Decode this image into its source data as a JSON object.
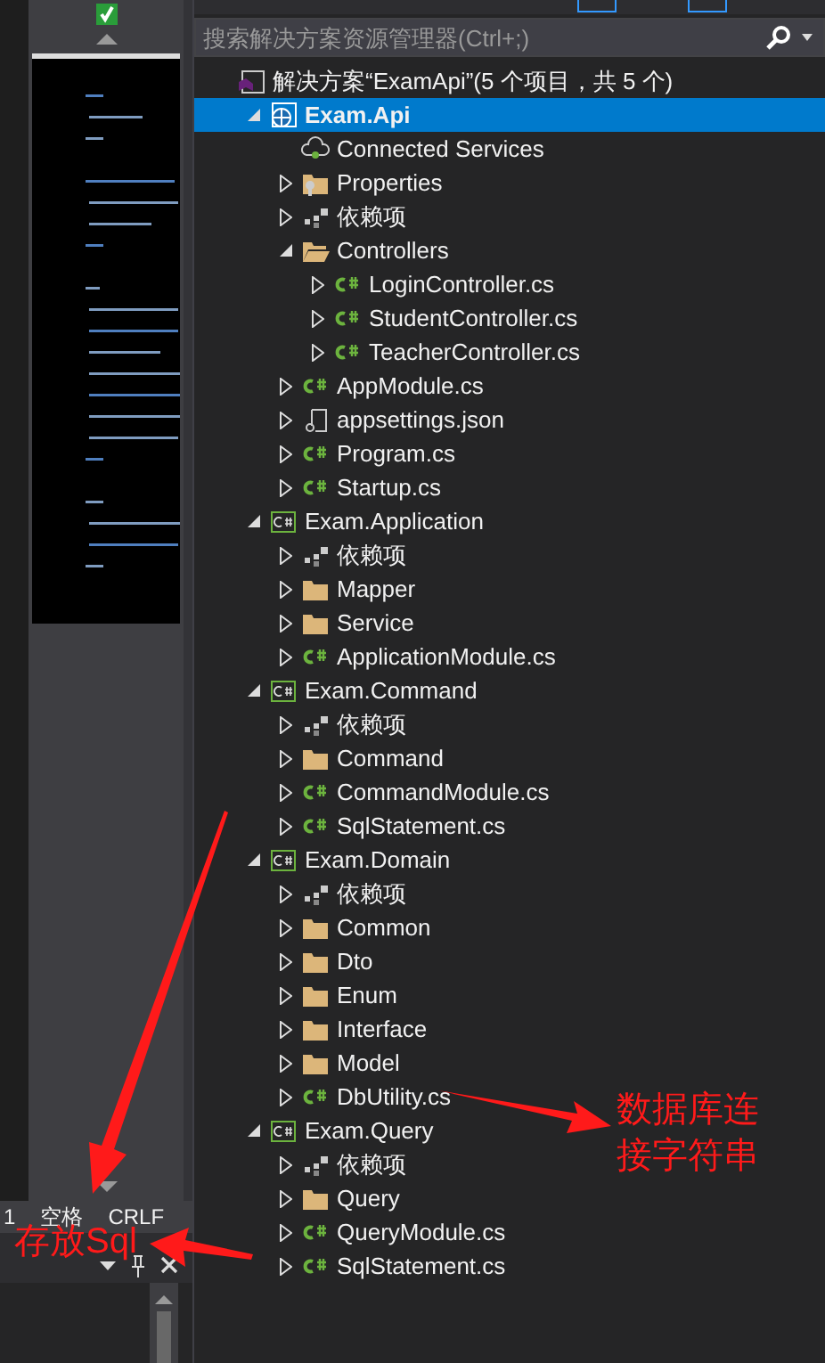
{
  "search": {
    "placeholder": "搜索解决方案资源管理器(Ctrl+;)"
  },
  "status_bar": {
    "column": "1",
    "indent": "空格",
    "line_ending": "CRLF"
  },
  "solution_tree": {
    "label": "解决方案“ExamApi”(5 个项目，共 5 个)",
    "kind": "solution",
    "selected": false,
    "children": [
      {
        "label": "Exam.Api",
        "kind": "web-project",
        "expanded": true,
        "selected": true,
        "children": [
          {
            "label": "Connected Services",
            "kind": "cloud",
            "selected": false
          },
          {
            "label": "Properties",
            "kind": "properties",
            "expanded": false,
            "selected": false
          },
          {
            "label": "依赖项",
            "kind": "dependencies",
            "expanded": false,
            "selected": false
          },
          {
            "label": "Controllers",
            "kind": "folder-open",
            "expanded": true,
            "selected": false,
            "children": [
              {
                "label": "LoginController.cs",
                "kind": "cs-file",
                "expanded": false,
                "selected": false
              },
              {
                "label": "StudentController.cs",
                "kind": "cs-file",
                "expanded": false,
                "selected": false
              },
              {
                "label": "TeacherController.cs",
                "kind": "cs-file",
                "expanded": false,
                "selected": false
              }
            ]
          },
          {
            "label": "AppModule.cs",
            "kind": "cs-file",
            "expanded": false,
            "selected": false
          },
          {
            "label": "appsettings.json",
            "kind": "json-file",
            "expanded": false,
            "selected": false
          },
          {
            "label": "Program.cs",
            "kind": "cs-file",
            "expanded": false,
            "selected": false
          },
          {
            "label": "Startup.cs",
            "kind": "cs-file",
            "expanded": false,
            "selected": false
          }
        ]
      },
      {
        "label": "Exam.Application",
        "kind": "csharp-project",
        "expanded": true,
        "selected": false,
        "children": [
          {
            "label": "依赖项",
            "kind": "dependencies",
            "expanded": false,
            "selected": false
          },
          {
            "label": "Mapper",
            "kind": "folder",
            "expanded": false,
            "selected": false
          },
          {
            "label": "Service",
            "kind": "folder",
            "expanded": false,
            "selected": false
          },
          {
            "label": "ApplicationModule.cs",
            "kind": "cs-file",
            "expanded": false,
            "selected": false
          }
        ]
      },
      {
        "label": "Exam.Command",
        "kind": "csharp-project",
        "expanded": true,
        "selected": false,
        "children": [
          {
            "label": "依赖项",
            "kind": "dependencies",
            "expanded": false,
            "selected": false
          },
          {
            "label": "Command",
            "kind": "folder",
            "expanded": false,
            "selected": false
          },
          {
            "label": "CommandModule.cs",
            "kind": "cs-file",
            "expanded": false,
            "selected": false
          },
          {
            "label": "SqlStatement.cs",
            "kind": "cs-file",
            "expanded": false,
            "selected": false
          }
        ]
      },
      {
        "label": "Exam.Domain",
        "kind": "csharp-project",
        "expanded": true,
        "selected": false,
        "children": [
          {
            "label": "依赖项",
            "kind": "dependencies",
            "expanded": false,
            "selected": false
          },
          {
            "label": "Common",
            "kind": "folder",
            "expanded": false,
            "selected": false
          },
          {
            "label": "Dto",
            "kind": "folder",
            "expanded": false,
            "selected": false
          },
          {
            "label": "Enum",
            "kind": "folder",
            "expanded": false,
            "selected": false
          },
          {
            "label": "Interface",
            "kind": "folder",
            "expanded": false,
            "selected": false
          },
          {
            "label": "Model",
            "kind": "folder",
            "expanded": false,
            "selected": false
          },
          {
            "label": "DbUtility.cs",
            "kind": "cs-file",
            "expanded": false,
            "selected": false
          }
        ]
      },
      {
        "label": "Exam.Query",
        "kind": "csharp-project",
        "expanded": true,
        "selected": false,
        "children": [
          {
            "label": "依赖项",
            "kind": "dependencies",
            "expanded": false,
            "selected": false
          },
          {
            "label": "Query",
            "kind": "folder",
            "expanded": false,
            "selected": false
          },
          {
            "label": "QueryModule.cs",
            "kind": "cs-file",
            "expanded": false,
            "selected": false
          },
          {
            "label": "SqlStatement.cs",
            "kind": "cs-file",
            "expanded": false,
            "selected": false
          }
        ]
      }
    ]
  },
  "annotations": [
    {
      "kind": "connection-string",
      "text": "数据库连接字符串"
    },
    {
      "kind": "sql",
      "text": "存放Sql"
    }
  ]
}
